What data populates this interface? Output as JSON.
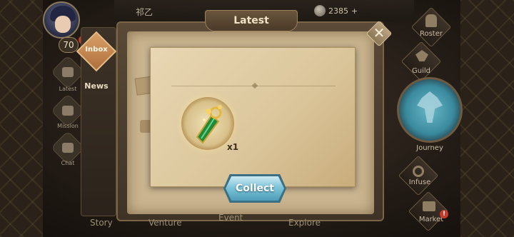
{
  "header": {
    "player_name": "祁乙",
    "currencies": [
      {
        "icon": "silver-coin-icon",
        "value": "2385"
      }
    ],
    "currency_add_symbol": "+"
  },
  "player": {
    "level": "70",
    "alert": "!"
  },
  "side_nav": [
    {
      "label": "Latest",
      "icon": "scroll-icon"
    },
    {
      "label": "Mission",
      "icon": "clipboard-icon"
    },
    {
      "label": "Chat",
      "icon": "chat-bubble-icon"
    }
  ],
  "tabs": [
    {
      "label": "Inbox",
      "active": true
    },
    {
      "label": "News",
      "active": false
    }
  ],
  "panel": {
    "title": "Latest",
    "close_symbol": "✕"
  },
  "reward": {
    "icon": "jade-gold-amulet-icon",
    "quantity": "x1"
  },
  "collect_label": "Collect",
  "right_nav": [
    {
      "label": "Roster",
      "icon": "helmet-icon"
    },
    {
      "label": "Guild",
      "icon": "bird-crest-icon"
    },
    {
      "label": "Journey",
      "icon": "tree-emblem-icon"
    },
    {
      "label": "Infuse",
      "icon": "swirl-icon"
    },
    {
      "label": "Market",
      "icon": "cart-icon"
    }
  ],
  "bottom_nav": [
    "Story",
    "Venture",
    "Event",
    "Explore"
  ],
  "colors": {
    "collect_button": "#7fc4d9",
    "active_tab": "#d9a067",
    "journey_orb": "#3a8a9e",
    "alert_badge": "#c63a2b"
  }
}
